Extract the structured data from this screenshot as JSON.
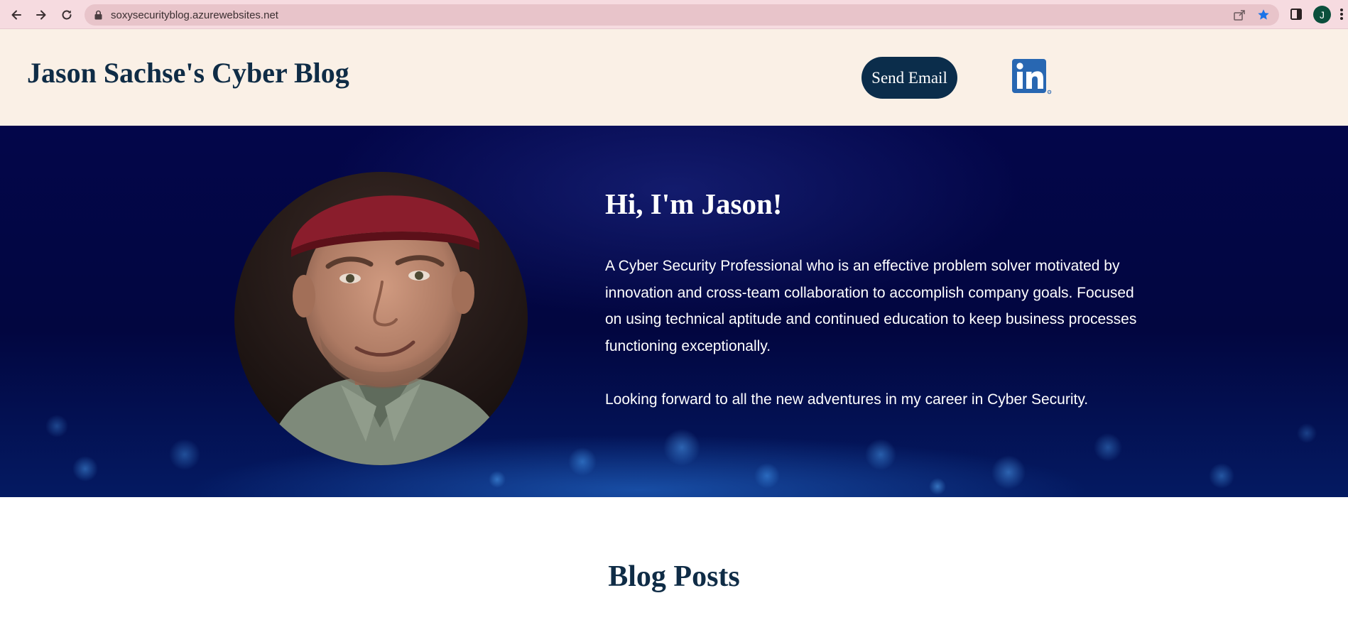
{
  "browser": {
    "url": "soxysecurityblog.azurewebsites.net",
    "profile_initial": "J",
    "icons": [
      "back-icon",
      "forward-icon",
      "reload-icon",
      "lock-icon",
      "share-icon",
      "bookmark-star-icon",
      "side-panel-icon",
      "menu-kebab-icon"
    ]
  },
  "header": {
    "title": "Jason Sachse's Cyber Blog",
    "email_button": "Send Email",
    "linkedin_logo_text": "in"
  },
  "hero": {
    "heading": "Hi, I'm Jason!",
    "paragraph_1": "A Cyber Security Professional who is an effective problem solver motivated by innovation and cross-team collaboration to accomplish company goals. Focused on using technical aptitude and continued education to keep business processes functioning exceptionally.",
    "paragraph_2": "Looking forward to all the new adventures in my career in Cyber Security."
  },
  "blog": {
    "heading": "Blog Posts"
  },
  "colors": {
    "chrome_bg": "#f6dbe0",
    "header_bg": "#faf0e6",
    "title_color": "#0f2c46",
    "button_bg": "#0b2d4b",
    "hero_bg": "#03064a",
    "linkedin_blue": "#2867b2"
  }
}
